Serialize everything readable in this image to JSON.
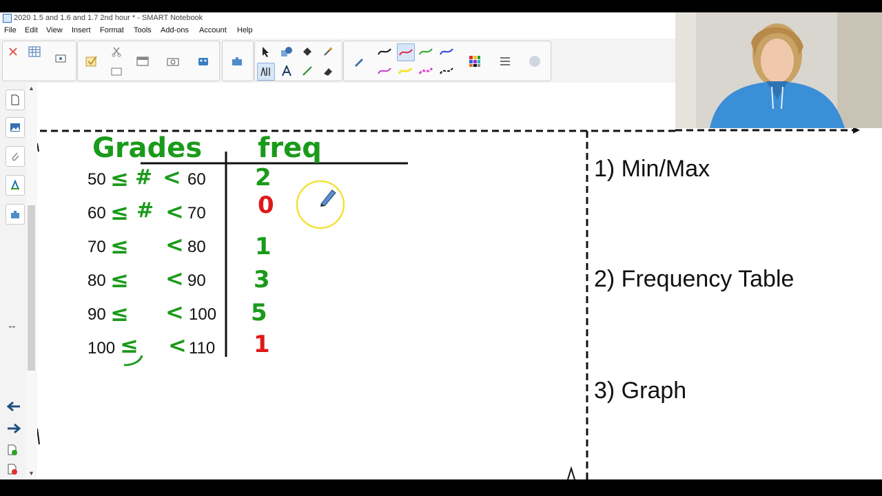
{
  "window": {
    "title": "2020 1.5 and 1.6 and 1.7 2nd hour * - SMART Notebook"
  },
  "menu": [
    "File",
    "Edit",
    "View",
    "Insert",
    "Format",
    "Tools",
    "Add-ons",
    "Account",
    "Help"
  ],
  "toolbar": {
    "icons": [
      "delete-icon",
      "table-icon",
      "screen-capture-icon",
      "check-icon",
      "cut-icon",
      "document-camera-icon",
      "screen-shade-icon",
      "camera-icon",
      "add-on-icon",
      "puzzle-icon",
      "select-icon",
      "shapes-icon",
      "fill-icon",
      "magic-pen-icon",
      "text-recognition-icon",
      "text-icon",
      "line-icon",
      "eraser-icon",
      "pen-icon",
      "pen-styles-icon",
      "color-palette-icon",
      "properties-icon",
      "more-icon"
    ],
    "pen_colors": [
      "#111111",
      "#e0284a",
      "#2aa22a",
      "#2a3fe0",
      "#c23ad1",
      "#f3e332",
      "#e23ad1",
      "#111111"
    ]
  },
  "side_tabs": [
    "page-sorter-icon",
    "gallery-icon",
    "attachments-icon",
    "properties-icon",
    "add-ons-icon"
  ],
  "table": {
    "header_grades": "Grades",
    "header_freq": "freq",
    "rows": [
      {
        "low": "50",
        "high": "60",
        "freq": "2"
      },
      {
        "low": "60",
        "high": "70",
        "freq": "0"
      },
      {
        "low": "70",
        "high": "80",
        "freq": "1"
      },
      {
        "low": "80",
        "high": "90",
        "freq": "3"
      },
      {
        "low": "90",
        "high": "100",
        "freq": "5"
      },
      {
        "low": "100",
        "high": "110",
        "freq": "1"
      }
    ]
  },
  "ink_symbols": {
    "leq": "≤",
    "lt": "<",
    "hash": "#"
  },
  "sections": [
    "1) Min/Max",
    "2) Frequency Table",
    "3) Graph"
  ],
  "colors": {
    "green_ink": "#1a9a1a",
    "red_ink": "#e01818",
    "dashed_border": "#111111",
    "pointer_ring": "#f2e23a"
  }
}
